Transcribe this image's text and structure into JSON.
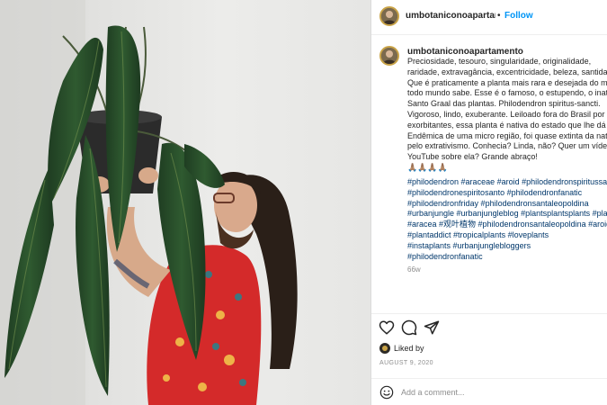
{
  "post": {
    "username": "umbotaniconoapartamento",
    "username_truncated": "umbotaniconoapartame",
    "follow_label": "Follow",
    "separator": "•",
    "caption_lines": [
      "Preciosidade, tesouro, singularidade, originalidade,",
      "raridade, extravagância, excentricidade, beleza, santidade.",
      "Que é praticamente a planta mais rara e desejada do mundo",
      "todo mundo sabe. Esse é o famoso, o estupendo, o inatingível",
      "Santo Graal das plantas. Philodendron spiritus-sancti.",
      "Vigoroso, lindo, exuberante. Leiloado fora do Brasil por valores",
      "exorbitantes, essa planta é nativa do estado que lhe dá nome.",
      "Endêmica de uma micro região, foi quase extinta da natureza",
      "pelo extrativismo. Conhecia? Linda, não? Quer um vídeo no",
      "YouTube sobre ela? Grande abraço!",
      "🙏🏽🙏🏽🙏🏽🙏🏽"
    ],
    "hashtag_lines": [
      "#philodendron #araceae #aroid #philodendronspiritussancti",
      "#philodendronespiritosanto #philodendronfanatic",
      "#philodendronfriday #philodendronsantaleopoldina",
      "#urbanjungle #urbanjungleblog #plantsplantsplants #plantlover",
      "#aracea #观叶植物 #philodendronsantaleopoldina #aroidaddict",
      "#plantaddict #tropicalplants #loveplants",
      "#instaplants #urbanjunglebloggers",
      "#philodendronfanatic"
    ],
    "age": "66w",
    "liked_by_label": "Liked by",
    "date": "AUGUST 9, 2020",
    "comment_placeholder": "Add a comment..."
  },
  "icons": {
    "like": "heart-icon",
    "comment": "comment-icon",
    "share": "paper-plane-icon",
    "emoji": "smiley-icon"
  },
  "colors": {
    "link": "#0095f6",
    "hashtag": "#00376b",
    "muted": "#8e8e8e",
    "text": "#262626"
  }
}
